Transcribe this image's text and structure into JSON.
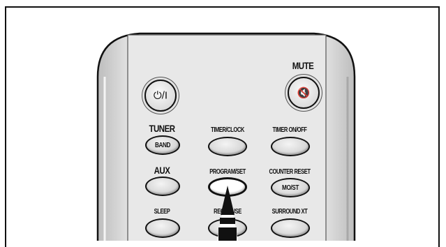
{
  "labels": {
    "mute": "MUTE",
    "tuner": "TUNER",
    "aux": "AUX",
    "sleep": "SLEEP",
    "timer_clock": "TIMER/CLOCK",
    "timer_onoff": "TIMER ON/OFF",
    "program_set": "PROGRAM/SET",
    "counter_reset": "COUNTER RESET",
    "rec_pause": "REC/PAUSE",
    "surround_xt": "SURROUND XT"
  },
  "buttons": {
    "power": "⏻/I",
    "mute": "🔇",
    "band": "BAND",
    "mo_st": "MO/ST"
  },
  "icons": [
    "power-icon",
    "mute-icon",
    "arrow-pointer-icon"
  ],
  "colors": {
    "body": "#e6e6e6",
    "outline": "#111111",
    "button": "#d4d4d4"
  }
}
